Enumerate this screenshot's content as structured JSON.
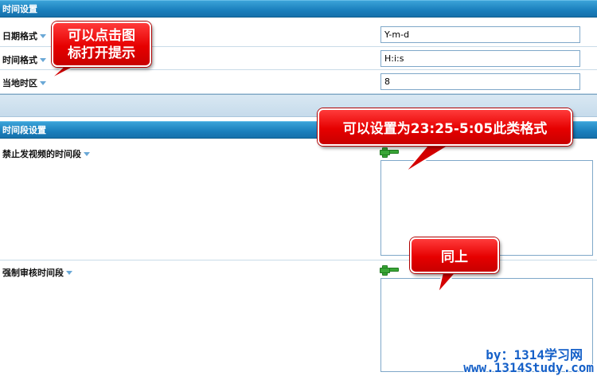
{
  "sections": {
    "time_settings": {
      "title": "时间设置"
    },
    "time_period_settings": {
      "title": "时间段设置"
    }
  },
  "time_settings": {
    "rows": [
      {
        "label": "日期格式",
        "value": "Y-m-d"
      },
      {
        "label": "时间格式",
        "value": "H:i:s"
      },
      {
        "label": "当地时区",
        "value": "8"
      }
    ]
  },
  "time_period_settings": {
    "rows": [
      {
        "label": "禁止发视频的时间段",
        "value": ""
      },
      {
        "label": "强制审核时间段",
        "value": ""
      }
    ]
  },
  "callouts": {
    "icon_hint": "可以点击图标打开提示",
    "icon_hint_line1": "可以点击图",
    "icon_hint_line2": "标打开提示",
    "format_hint": "可以设置为23:25-5:05此类格式",
    "same_hint": "同上"
  },
  "watermark": {
    "line1": "by：1314学习网",
    "line2": "www.1314Study.com"
  },
  "icons": {
    "dropdown": "chevron-down-icon",
    "add": "plus-icon",
    "remove": "minus-icon"
  },
  "colors": {
    "header_blue": "#1a7fbc",
    "callout_red": "#e60000",
    "watermark_blue": "#1560c8",
    "add_green": "#3aa637"
  }
}
